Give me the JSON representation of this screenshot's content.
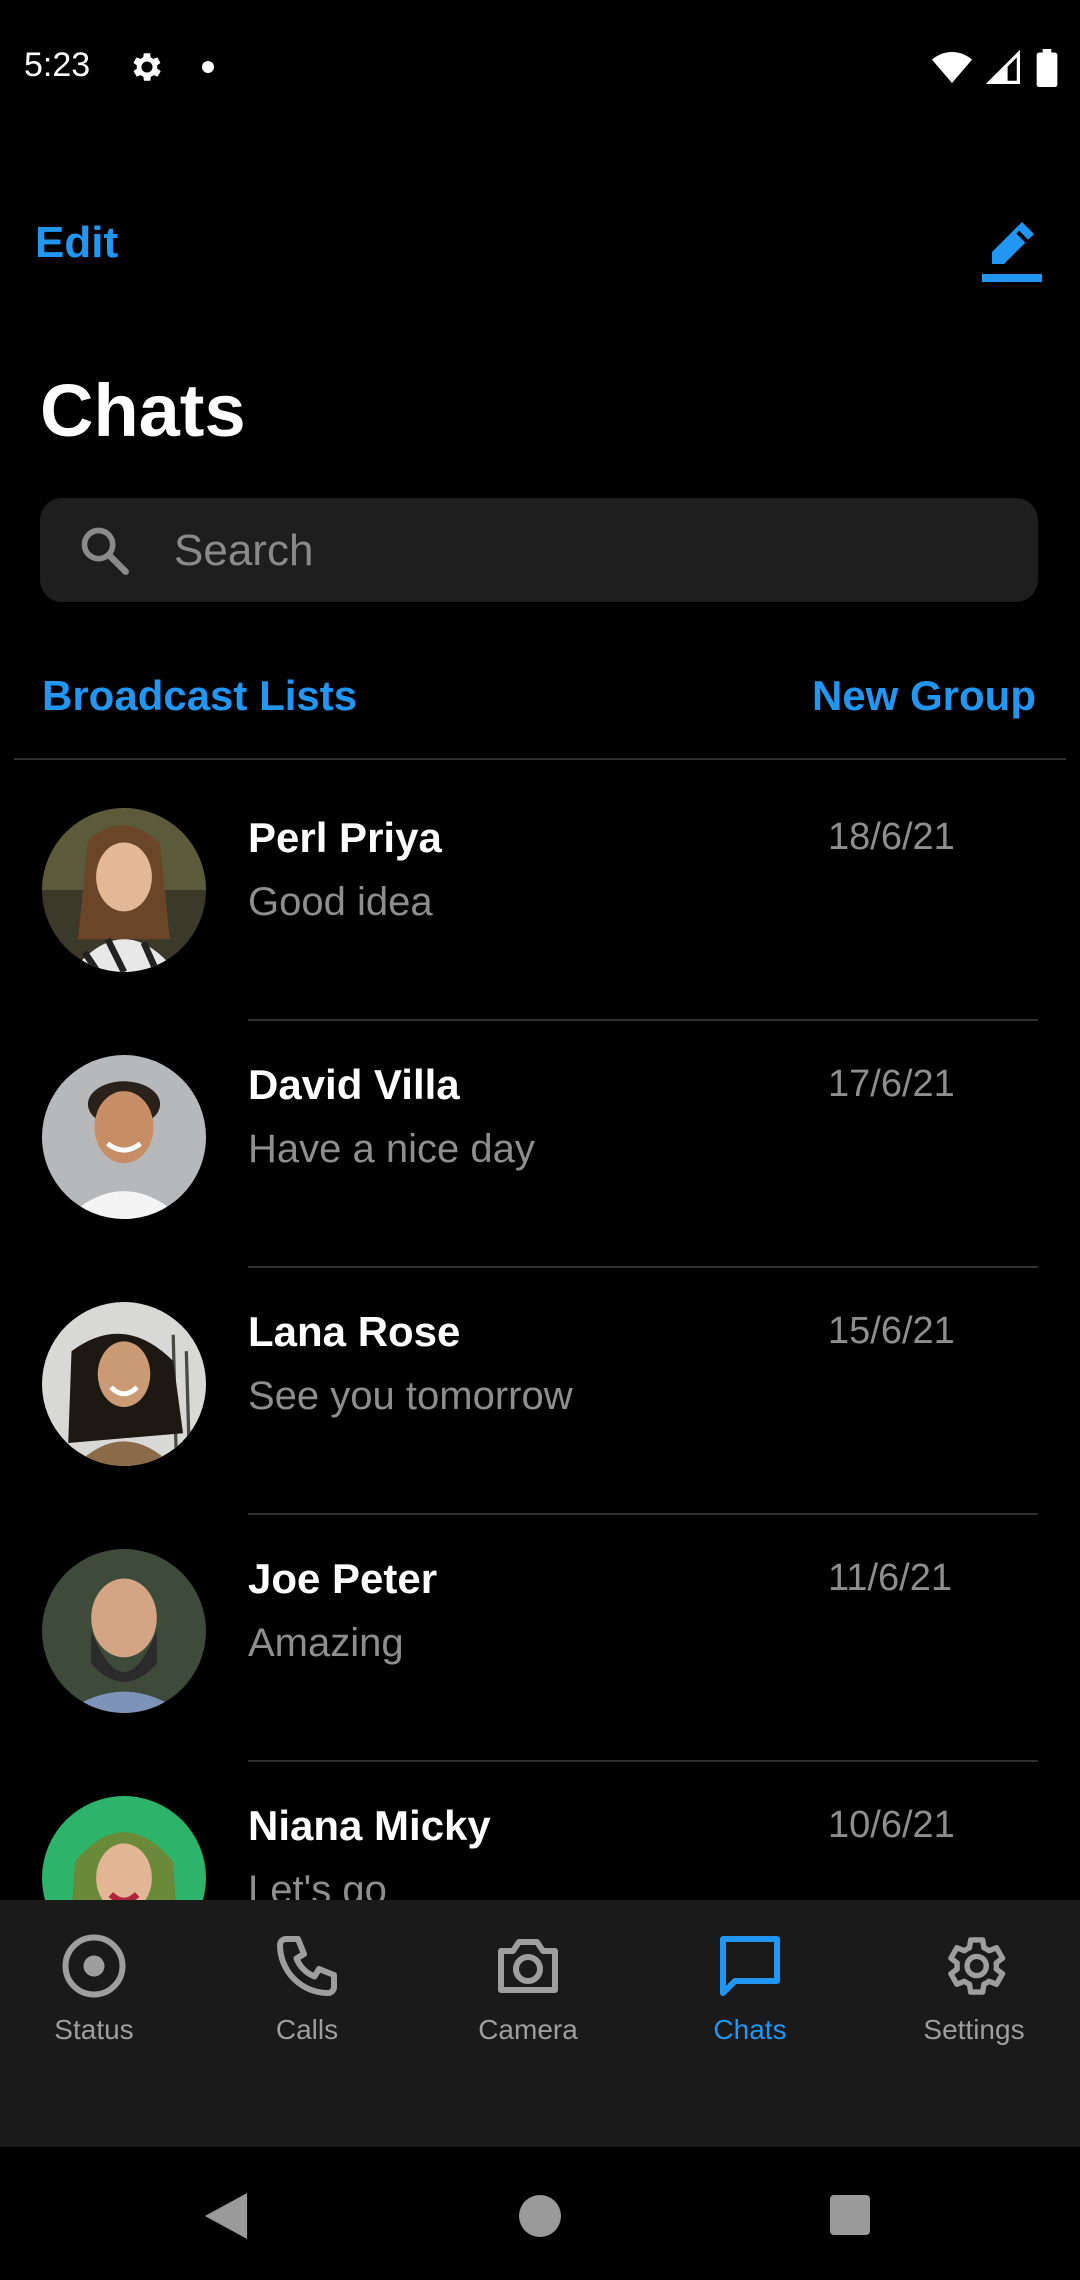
{
  "status_bar": {
    "time": "5:23",
    "icons": [
      "settings-gear-icon",
      "notification-dot-icon",
      "wifi-icon",
      "signal-icon",
      "battery-icon"
    ]
  },
  "header": {
    "edit_label": "Edit",
    "compose_icon": "compose-pencil-icon",
    "title": "Chats"
  },
  "search": {
    "placeholder": "Search",
    "value": ""
  },
  "links": {
    "broadcast": "Broadcast Lists",
    "new_group": "New Group"
  },
  "chats": [
    {
      "name": "Perl Priya",
      "message": "Good idea",
      "date": "18/6/21"
    },
    {
      "name": "David Villa",
      "message": "Have a nice day",
      "date": "17/6/21"
    },
    {
      "name": "Lana Rose",
      "message": "See you tomorrow",
      "date": "15/6/21"
    },
    {
      "name": "Joe Peter",
      "message": "Amazing",
      "date": "11/6/21"
    },
    {
      "name": "Niana Micky",
      "message": "Let's go",
      "date": "10/6/21"
    }
  ],
  "tabs": [
    {
      "label": "Status",
      "icon": "status-icon",
      "active": false
    },
    {
      "label": "Calls",
      "icon": "phone-icon",
      "active": false
    },
    {
      "label": "Camera",
      "icon": "camera-icon",
      "active": false
    },
    {
      "label": "Chats",
      "icon": "chat-bubble-icon",
      "active": true
    },
    {
      "label": "Settings",
      "icon": "settings-icon",
      "active": false
    }
  ],
  "colors": {
    "accent": "#2196f3",
    "background": "#000000",
    "tab_bar": "#1a1a1a",
    "search_bg": "#1e1e1e",
    "secondary_text": "#8e8e8e"
  }
}
